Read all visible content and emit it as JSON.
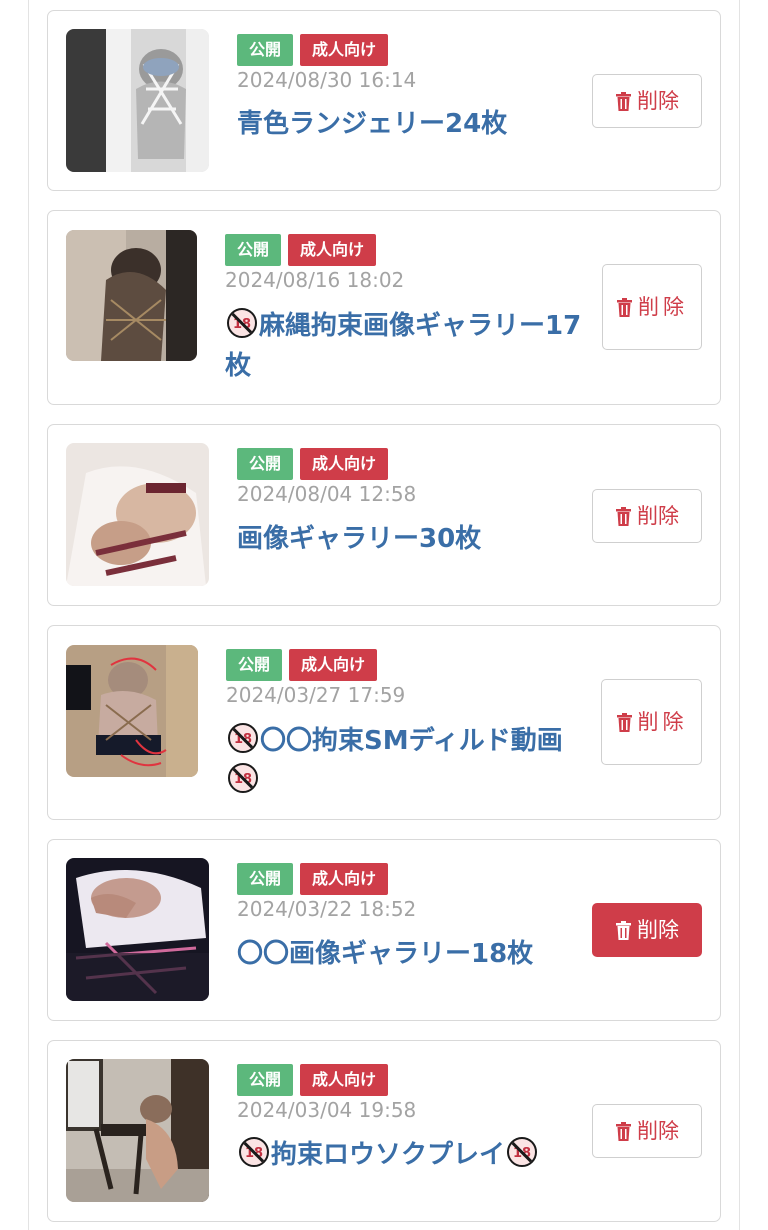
{
  "posts": [
    {
      "badges": {
        "public": "公開",
        "adult": "成人向け"
      },
      "date": "2024/08/30 16:14",
      "title": "青色ランジェリー24枚",
      "delete_label": "削除",
      "thumb_colors": [
        "#dcdcdc",
        "#8a8a8a",
        "#2f2f2f"
      ]
    },
    {
      "badges": {
        "public": "公開",
        "adult": "成人向け"
      },
      "date": "2024/08/16 18:02",
      "title": "麻縄拘束画像ギャラリー17枚",
      "r18_before": "18",
      "delete_label": "削除",
      "thumb_colors": [
        "#b3a89c",
        "#5a4a3e",
        "#2a2522"
      ]
    },
    {
      "badges": {
        "public": "公開",
        "adult": "成人向け"
      },
      "date": "2024/08/04 12:58",
      "title": "画像ギャラリー30枚",
      "delete_label": "削除",
      "thumb_colors": [
        "#f1ebe8",
        "#c9a996",
        "#7a3b44"
      ]
    },
    {
      "badges": {
        "public": "公開",
        "adult": "成人向け"
      },
      "date": "2024/03/27 17:59",
      "title": "〇〇拘束SMディルド動画",
      "r18_before": "18",
      "r18_after": "18",
      "delete_label": "削除",
      "thumb_colors": [
        "#c8b59b",
        "#6b5a4a",
        "#1e2430"
      ]
    },
    {
      "badges": {
        "public": "公開",
        "adult": "成人向け"
      },
      "date": "2024/03/22 18:52",
      "title": "〇〇画像ギャラリー18枚",
      "delete_label": "削除",
      "delete_active": true,
      "thumb_colors": [
        "#e9e6ee",
        "#b08c86",
        "#1c1b2e"
      ]
    },
    {
      "badges": {
        "public": "公開",
        "adult": "成人向け"
      },
      "date": "2024/03/04 19:58",
      "title": "拘束ロウソクプレイ",
      "r18_before": "18",
      "r18_after": "18",
      "delete_label": "削除",
      "thumb_colors": [
        "#bdb6ad",
        "#6e5a4b",
        "#2c2622"
      ]
    }
  ]
}
